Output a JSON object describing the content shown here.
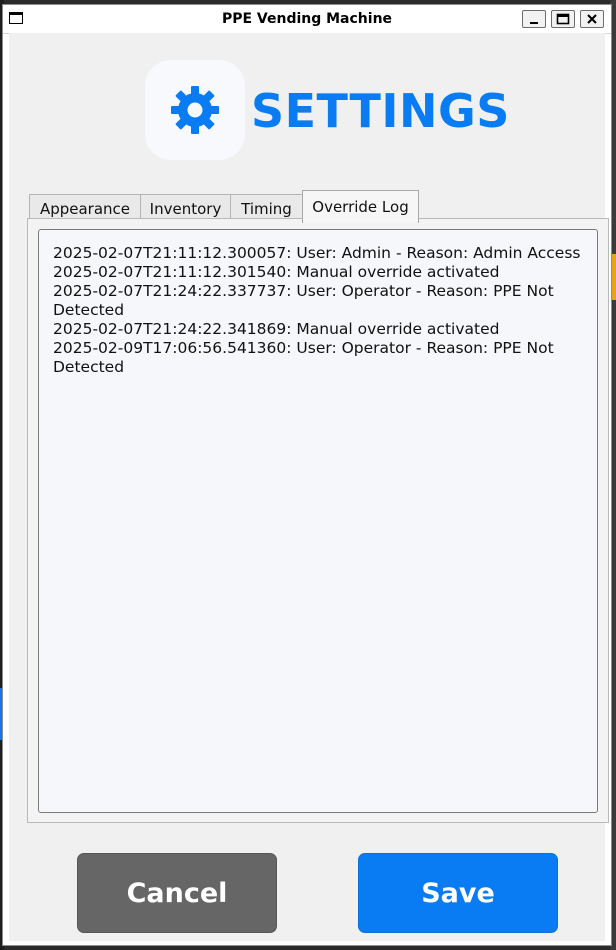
{
  "window": {
    "title": "PPE Vending Machine",
    "controls": [
      "minimize-icon",
      "maximize-icon",
      "close-icon"
    ]
  },
  "header": {
    "icon": "gear-icon",
    "title": "SETTINGS",
    "accent_color": "#0a7cf3"
  },
  "tabs": [
    {
      "label": "Appearance",
      "active": false
    },
    {
      "label": "Inventory",
      "active": false
    },
    {
      "label": "Timing",
      "active": false
    },
    {
      "label": "Override Log",
      "active": true
    }
  ],
  "override_log": {
    "entries": [
      "2025-02-07T21:11:12.300057: User: Admin - Reason: Admin Access",
      "2025-02-07T21:11:12.301540: Manual override activated",
      "2025-02-07T21:24:22.337737: User: Operator - Reason: PPE Not Detected",
      "2025-02-07T21:24:22.341869: Manual override activated",
      "2025-02-09T17:06:56.541360: User: Operator - Reason: PPE Not Detected"
    ]
  },
  "buttons": {
    "cancel_label": "Cancel",
    "save_label": "Save",
    "cancel_color": "#666666",
    "save_color": "#0a7cf3"
  }
}
